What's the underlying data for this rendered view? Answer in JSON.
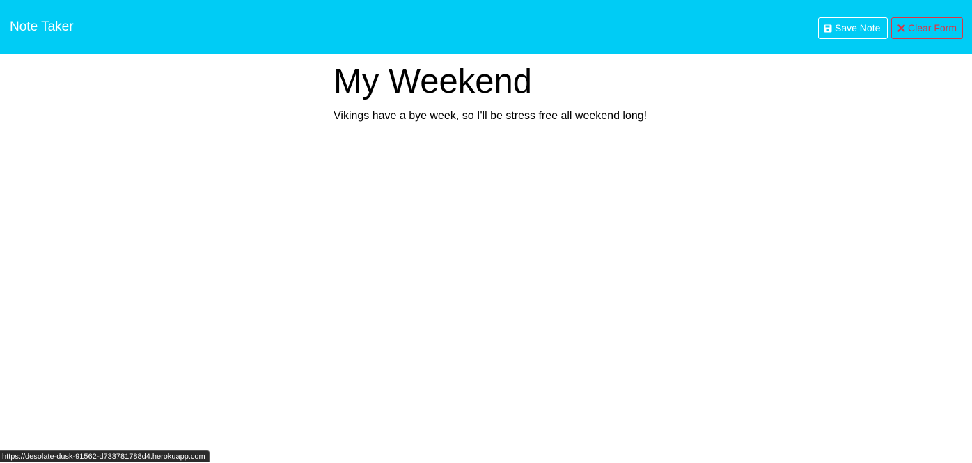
{
  "navbar": {
    "brand": "Note Taker",
    "save_label": "Save Note",
    "save_icon": "floppy-disk-icon",
    "clear_label": "Clear Form",
    "clear_icon": "x-icon"
  },
  "colors": {
    "navbar_bg": "#00ccf5",
    "danger": "#dc3545"
  },
  "note": {
    "title": "My Weekend",
    "text": "Vikings have a bye week, so I'll be stress free all weekend long!"
  },
  "status_bar": {
    "url": "https://desolate-dusk-91562-d733781788d4.herokuapp.com"
  }
}
